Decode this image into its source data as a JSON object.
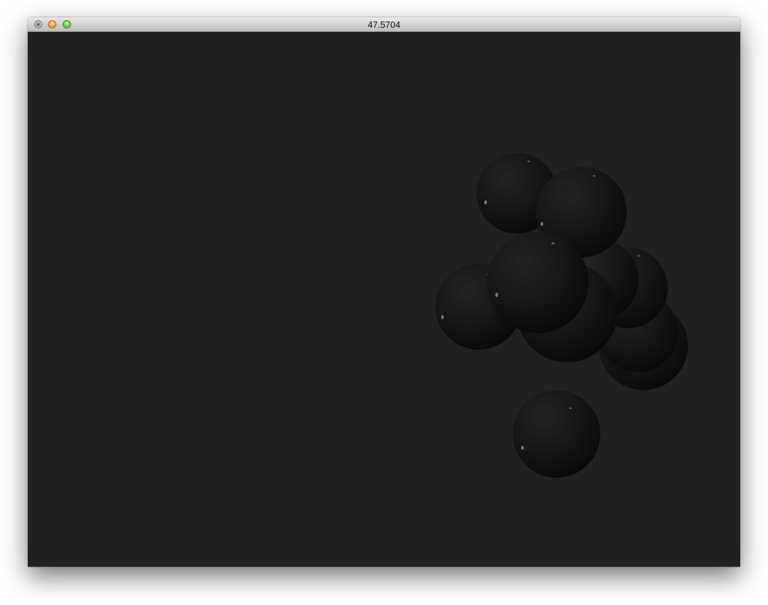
{
  "window": {
    "title": "47.5704"
  },
  "scene": {
    "background_color": "#212121",
    "object_type": "sphere",
    "sphere_color": "#141414"
  }
}
